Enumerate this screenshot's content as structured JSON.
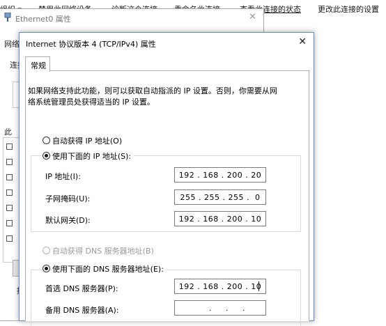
{
  "command_bar": {
    "items": [
      "禁用此网络设备",
      "诊断这个连接",
      "重命名此连接",
      "查看此连接的状态",
      "更改此连接的设置"
    ],
    "left_fragment": "组织 ▾"
  },
  "bg_window": {
    "title": "Ethernet0 属性",
    "close": "✕",
    "frag_net": "网络",
    "frag_connect": "连接",
    "frag_this": "此",
    "frag_desc": "描"
  },
  "dialog": {
    "title": "Internet 协议版本 4 (TCP/IPv4) 属性",
    "close": "✕",
    "tab": "常规",
    "description": "如果网络支持此功能，则可以获取自动指派的 IP 设置。否则，你需要从网络系统管理员处获得适当的 IP 设置。",
    "ip": {
      "auto_label": "自动获得 IP 地址(O)",
      "manual_label": "使用下面的 IP 地址(S):",
      "selected": "manual",
      "fields": [
        {
          "label": "IP 地址(I):",
          "value": "192 . 168 . 200 . 20"
        },
        {
          "label": "子网掩码(U):",
          "value": "255 . 255 . 255 .  0"
        },
        {
          "label": "默认网关(D):",
          "value": "192 . 168 . 200 . 10"
        }
      ]
    },
    "dns": {
      "auto_label": "自动获得 DNS 服务器地址(B)",
      "manual_label": "使用下面的 DNS 服务器地址(E):",
      "selected": "manual",
      "fields": [
        {
          "label": "首选 DNS 服务器(P):",
          "value": "192 . 168 . 200 . 10"
        },
        {
          "label": "备用 DNS 服务器(A):",
          "value": "     .     .     ."
        }
      ]
    }
  }
}
